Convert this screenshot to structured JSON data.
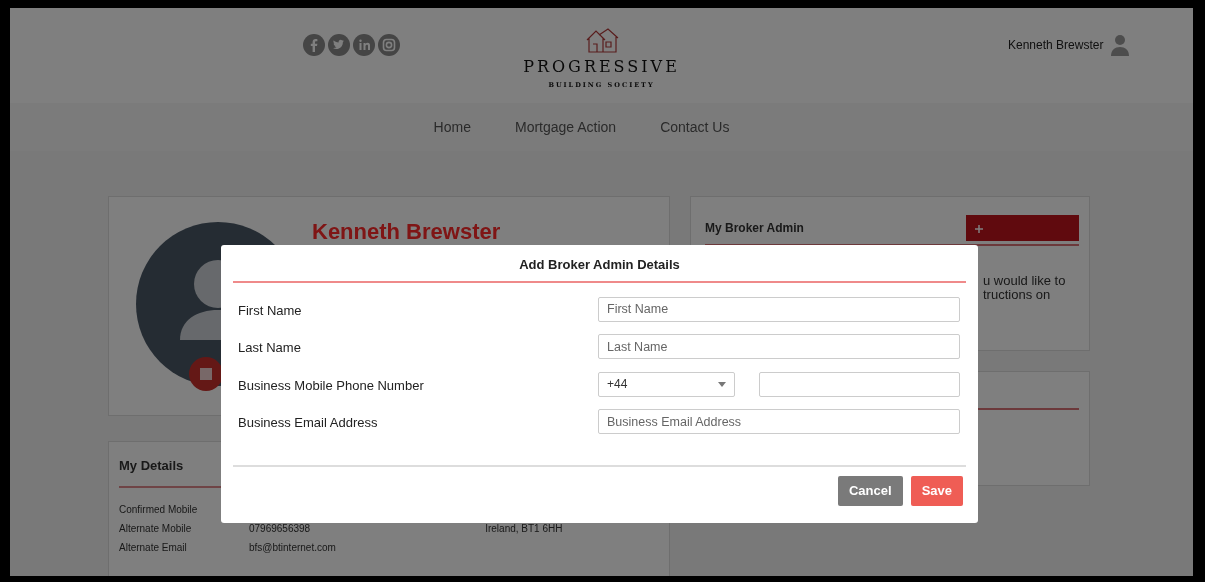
{
  "header": {
    "logo": {
      "name": "PROGRESSIVE",
      "tagline": "BUILDING SOCIETY"
    },
    "user": "Kenneth Brewster"
  },
  "nav": [
    "Home",
    "Mortgage Action",
    "Contact Us"
  ],
  "profile_card": {
    "name": "Kenneth Brewster"
  },
  "broker_admin_card": {
    "title": "My Broker Admin",
    "text_lines": [
      "u would like to",
      "tructions on"
    ]
  },
  "details_card": {
    "title": "My Details",
    "rows": [
      {
        "label": "Confirmed Mobile"
      },
      {
        "label": "Alternate Mobile",
        "value": "07969656398"
      },
      {
        "label": "Alternate Email",
        "value": "bfs@btinternet.com"
      }
    ],
    "address": "Ireland, BT1 6HH"
  },
  "modal": {
    "title": "Add Broker Admin Details",
    "fields": [
      {
        "kind": "text",
        "label": "First Name",
        "placeholder": "First Name"
      },
      {
        "kind": "text",
        "label": "Last Name",
        "placeholder": "Last Name"
      },
      {
        "kind": "phone",
        "label": "Business Mobile Phone Number",
        "code": "+44"
      },
      {
        "kind": "text",
        "label": "Business Email Address",
        "placeholder": "Business Email Address"
      }
    ],
    "buttons": [
      {
        "label": "Cancel",
        "kind": "secondary"
      },
      {
        "label": "Save",
        "kind": "primary"
      }
    ]
  }
}
